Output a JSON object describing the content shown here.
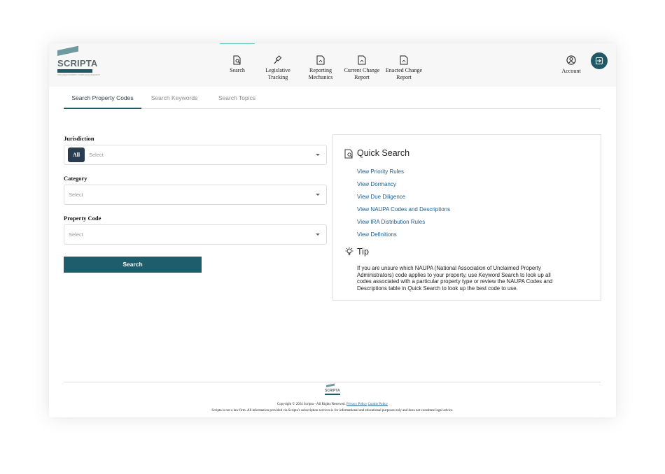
{
  "brand": {
    "name": "SCRIPTA",
    "tagline": "UNCLAIMED PROPERTY COMPLIANCE RESEARCH"
  },
  "nav": {
    "items": [
      {
        "label": "Search",
        "icon": "search-document-icon",
        "active": true
      },
      {
        "label": "Legislative Tracking",
        "icon": "gavel-icon",
        "active": false
      },
      {
        "label": "Reporting Mechanics",
        "icon": "pdf-document-icon",
        "active": false
      },
      {
        "label": "Current Change Report",
        "icon": "pdf-document-icon",
        "active": false
      },
      {
        "label": "Enacted Change Report",
        "icon": "pdf-document-icon",
        "active": false
      }
    ],
    "account_label": "Account",
    "logout_icon": "logout-icon"
  },
  "tabs": [
    {
      "label": "Search Property Codes",
      "active": true
    },
    {
      "label": "Search Keywords",
      "active": false
    },
    {
      "label": "Search Topics",
      "active": false
    }
  ],
  "form": {
    "jurisdiction": {
      "label": "Jurisdiction",
      "badge": "All",
      "placeholder": "Select"
    },
    "category": {
      "label": "Category",
      "placeholder": "Select"
    },
    "property_code": {
      "label": "Property Code",
      "placeholder": "Select"
    },
    "search_button": "Search"
  },
  "quick_search": {
    "title": "Quick Search",
    "links": [
      "View Priority Rules",
      "View Dormancy",
      "View Due Diligence",
      "View NAUPA Codes and Descriptions",
      "View IRA Distribution Rules",
      "View Definitions"
    ]
  },
  "tip": {
    "title": "Tip",
    "text": "If you are unsure which NAUPA (National Association of Unclaimed Property Administrators) code applies to your property, use Keyword Search to look up all codes associated with a particular property type or review the NAUPA Codes and Descriptions table in Quick Search to look up the best code to use."
  },
  "footer": {
    "copyright": "Copyright © 2024 Scripta - All Rights Reserved.",
    "privacy_link": "Privacy Policy",
    "cookie_link": "Cookie Policy",
    "disclaimer": "Scripta is not a law firm. All information provided via Scripta's subscription services is for informational and educational purposes only and does not constitute legal advice."
  },
  "colors": {
    "accent": "#1f5966",
    "tab_indicator": "#5fc3c0",
    "link": "#1f5d8a"
  }
}
